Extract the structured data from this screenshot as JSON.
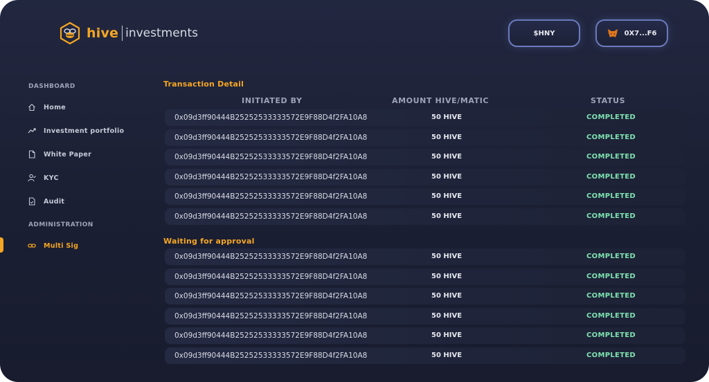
{
  "brand": {
    "name_bold": "hive",
    "name_rest": "investments"
  },
  "header": {
    "token_button": "$HNY",
    "wallet_button": "0X7...F6"
  },
  "sidebar": {
    "dashboard_heading": "DASHBOARD",
    "dashboard_items": [
      {
        "label": "Home",
        "icon": "home-icon"
      },
      {
        "label": "Investment portfolio",
        "icon": "trend-icon"
      },
      {
        "label": "White Paper",
        "icon": "document-icon"
      },
      {
        "label": "KYC",
        "icon": "user-check-icon"
      },
      {
        "label": "Audit",
        "icon": "audit-icon"
      }
    ],
    "admin_heading": "ADMINISTRATION",
    "admin_items": [
      {
        "label": "Multi Sig",
        "icon": "link-icon",
        "active": true
      }
    ]
  },
  "columns": {
    "initiated_by": "INITIATED BY",
    "amount": "AMOUNT HIVE/MATIC",
    "status": "STATUS"
  },
  "transaction_detail": {
    "title": "Transaction Detail",
    "rows": [
      {
        "initiated_by": "0x09d3ff90444B25252533333572E9F88D4f2FA10A8",
        "amount": "50 HIVE",
        "status": "COMPLETED"
      },
      {
        "initiated_by": "0x09d3ff90444B25252533333572E9F88D4f2FA10A8",
        "amount": "50 HIVE",
        "status": "COMPLETED"
      },
      {
        "initiated_by": "0x09d3ff90444B25252533333572E9F88D4f2FA10A8",
        "amount": "50 HIVE",
        "status": "COMPLETED"
      },
      {
        "initiated_by": "0x09d3ff90444B25252533333572E9F88D4f2FA10A8",
        "amount": "50 HIVE",
        "status": "COMPLETED"
      },
      {
        "initiated_by": "0x09d3ff90444B25252533333572E9F88D4f2FA10A8",
        "amount": "50 HIVE",
        "status": "COMPLETED"
      },
      {
        "initiated_by": "0x09d3ff90444B25252533333572E9F88D4f2FA10A8",
        "amount": "50 HIVE",
        "status": "COMPLETED"
      }
    ]
  },
  "waiting_for_approval": {
    "title": "Waiting for approval",
    "rows": [
      {
        "initiated_by": "0x09d3ff90444B25252533333572E9F88D4f2FA10A8",
        "amount": "50 HIVE",
        "status": "COMPLETED"
      },
      {
        "initiated_by": "0x09d3ff90444B25252533333572E9F88D4f2FA10A8",
        "amount": "50 HIVE",
        "status": "COMPLETED"
      },
      {
        "initiated_by": "0x09d3ff90444B25252533333572E9F88D4f2FA10A8",
        "amount": "50 HIVE",
        "status": "COMPLETED"
      },
      {
        "initiated_by": "0x09d3ff90444B25252533333572E9F88D4f2FA10A8",
        "amount": "50 HIVE",
        "status": "COMPLETED"
      },
      {
        "initiated_by": "0x09d3ff90444B25252533333572E9F88D4f2FA10A8",
        "amount": "50 HIVE",
        "status": "COMPLETED"
      },
      {
        "initiated_by": "0x09d3ff90444B25252533333572E9F88D4f2FA10A8",
        "amount": "50 HIVE",
        "status": "COMPLETED"
      }
    ]
  },
  "colors": {
    "accent": "#f5a623",
    "status_completed": "#7fe3b0",
    "background": "#1b1f33",
    "button_border": "#6b7bbd"
  }
}
